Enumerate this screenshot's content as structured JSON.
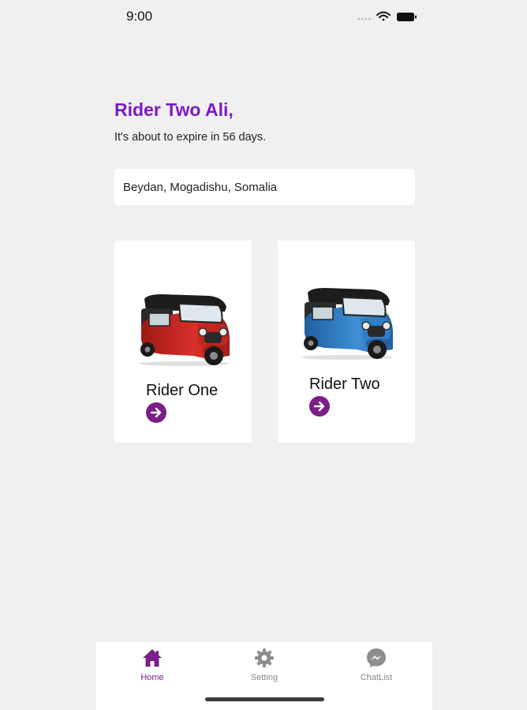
{
  "status_bar": {
    "time": "9:00"
  },
  "greeting": {
    "title": "Rider Two Ali,",
    "subtitle": "It's about to expire in 56 days."
  },
  "location": {
    "value": "Beydan, Mogadishu, Somalia"
  },
  "riders": [
    {
      "label": "Rider One",
      "vehicle_color": "#c9261f"
    },
    {
      "label": "Rider Two",
      "vehicle_color": "#3a86cf"
    }
  ],
  "tabs": [
    {
      "label": "Home",
      "icon": "home-icon",
      "active": true
    },
    {
      "label": "Setting",
      "icon": "gear-icon",
      "active": false
    },
    {
      "label": "ChatList",
      "icon": "messenger-icon",
      "active": false
    }
  ],
  "colors": {
    "accent": "#7d19c7",
    "button": "#7a1f86",
    "background": "#f0f0f0"
  }
}
